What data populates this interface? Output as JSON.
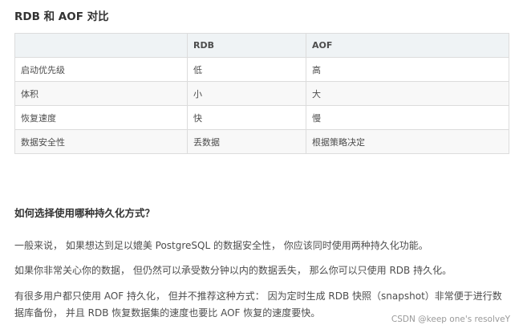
{
  "title": "RDB 和 AOF 对比",
  "table": {
    "headers": [
      "",
      "RDB",
      "AOF"
    ],
    "rows": [
      [
        "启动优先级",
        "低",
        "高"
      ],
      [
        "体积",
        "小",
        "大"
      ],
      [
        "恢复速度",
        "快",
        "慢"
      ],
      [
        "数据安全性",
        "丢数据",
        "根据策略决定"
      ]
    ]
  },
  "subtitle": "如何选择使用哪种持久化方式？",
  "paragraphs": [
    "一般来说， 如果想达到足以媲美 PostgreSQL 的数据安全性， 你应该同时使用两种持久化功能。",
    "如果你非常关心你的数据， 但仍然可以承受数分钟以内的数据丢失， 那么你可以只使用 RDB 持久化。",
    "有很多用户都只使用 AOF 持久化， 但并不推荐这种方式： 因为定时生成 RDB 快照（snapshot）非常便于进行数据库备份， 并且 RDB 恢复数据集的速度也要比 AOF 恢复的速度要快。"
  ],
  "watermark": "CSDN @keep one's resolveY"
}
